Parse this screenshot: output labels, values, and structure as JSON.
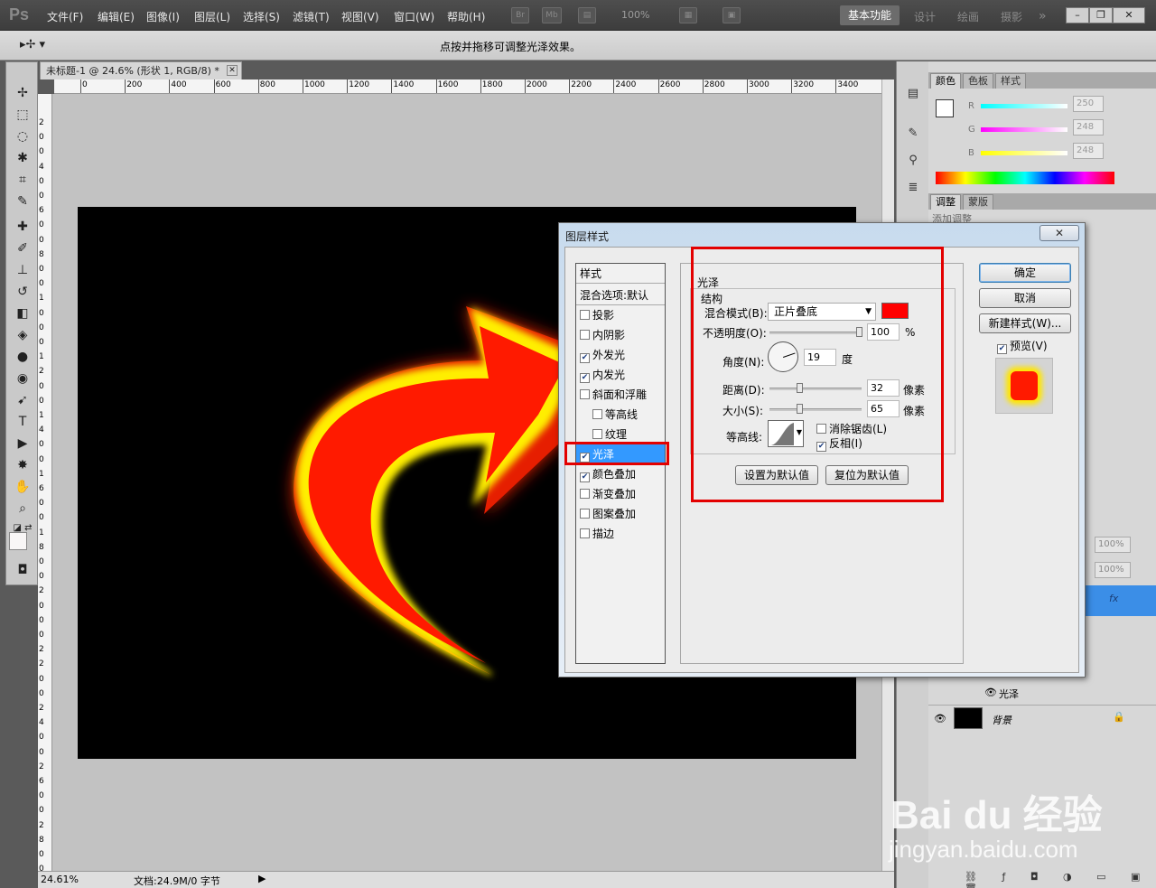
{
  "menubar": {
    "logo": "Ps",
    "items": [
      "文件(F)",
      "编辑(E)",
      "图像(I)",
      "图层(L)",
      "选择(S)",
      "滤镜(T)",
      "视图(V)",
      "窗口(W)",
      "帮助(H)"
    ],
    "zoom": "100%",
    "workspaces": {
      "active": "基本功能",
      "others": [
        "设计",
        "绘画",
        "摄影"
      ]
    }
  },
  "optionsbar": {
    "hint": "点按并拖移可调整光泽效果。"
  },
  "document": {
    "tab_title": "未标题-1 @ 24.6% (形状 1, RGB/8) *",
    "ruler_h": [
      "0",
      "200",
      "400",
      "600",
      "800",
      "1000",
      "1200",
      "1400",
      "1600",
      "1800",
      "2000",
      "2200",
      "2400",
      "2600",
      "2800",
      "3000",
      "3200",
      "3400"
    ],
    "ruler_v": [
      "2",
      "0",
      "0",
      "4",
      "0",
      "0",
      "6",
      "0",
      "0",
      "8",
      "0",
      "0",
      "1",
      "0",
      "0",
      "0",
      "1",
      "2",
      "0",
      "0",
      "1",
      "4",
      "0",
      "0",
      "1",
      "6",
      "0",
      "0",
      "1",
      "8",
      "0",
      "0",
      "2",
      "0",
      "0",
      "0",
      "2",
      "2",
      "0",
      "0",
      "2",
      "4",
      "0",
      "0",
      "2",
      "6",
      "0",
      "0",
      "2",
      "8",
      "0",
      "0"
    ],
    "status_zoom": "24.61%",
    "status_doc": "文档:24.9M/0 字节"
  },
  "panels": {
    "color_tabs": [
      "颜色",
      "色板",
      "样式"
    ],
    "rgb": [
      {
        "label": "R",
        "value": "250"
      },
      {
        "label": "G",
        "value": "248"
      },
      {
        "label": "B",
        "value": "248"
      }
    ],
    "adjust_tabs": [
      "调整",
      "蒙版"
    ],
    "adjust_partial": "添加调整",
    "opacity": "100%",
    "fill": "100%",
    "layers": [
      {
        "name": "光泽"
      },
      {
        "name": "背景"
      }
    ],
    "layer_fx": "fx"
  },
  "dialog": {
    "title": "图层样式",
    "close": "✕",
    "styles_header": "样式",
    "blend_options": "混合选项:默认",
    "style_items": [
      {
        "label": "投影",
        "checked": false,
        "indent": false
      },
      {
        "label": "内阴影",
        "checked": false,
        "indent": false
      },
      {
        "label": "外发光",
        "checked": true,
        "indent": false
      },
      {
        "label": "内发光",
        "checked": true,
        "indent": false
      },
      {
        "label": "斜面和浮雕",
        "checked": false,
        "indent": false
      },
      {
        "label": "等高线",
        "checked": false,
        "indent": true
      },
      {
        "label": "纹理",
        "checked": false,
        "indent": true
      },
      {
        "label": "光泽",
        "checked": true,
        "indent": false,
        "selected": true
      },
      {
        "label": "颜色叠加",
        "checked": true,
        "indent": false
      },
      {
        "label": "渐变叠加",
        "checked": false,
        "indent": false
      },
      {
        "label": "图案叠加",
        "checked": false,
        "indent": false
      },
      {
        "label": "描边",
        "checked": false,
        "indent": false
      }
    ],
    "section_title": "光泽",
    "structure_title": "结构",
    "blend_mode_label": "混合模式(B):",
    "blend_mode_value": "正片叠底",
    "blend_color": "#ff0000",
    "opacity_label": "不透明度(O):",
    "opacity_value": "100",
    "opacity_unit": "%",
    "angle_label": "角度(N):",
    "angle_value": "19",
    "angle_unit": "度",
    "distance_label": "距离(D):",
    "distance_value": "32",
    "distance_unit": "像素",
    "size_label": "大小(S):",
    "size_value": "65",
    "size_unit": "像素",
    "contour_label": "等高线:",
    "antialias_label": "消除锯齿(L)",
    "antialias_checked": false,
    "invert_label": "反相(I)",
    "invert_checked": true,
    "set_default": "设置为默认值",
    "reset_default": "复位为默认值",
    "ok": "确定",
    "cancel": "取消",
    "new_style": "新建样式(W)...",
    "preview_label": "预览(V)",
    "preview_checked": true
  },
  "watermark": {
    "brand": "Bai du 经验",
    "url": "jingyan.baidu.com"
  }
}
